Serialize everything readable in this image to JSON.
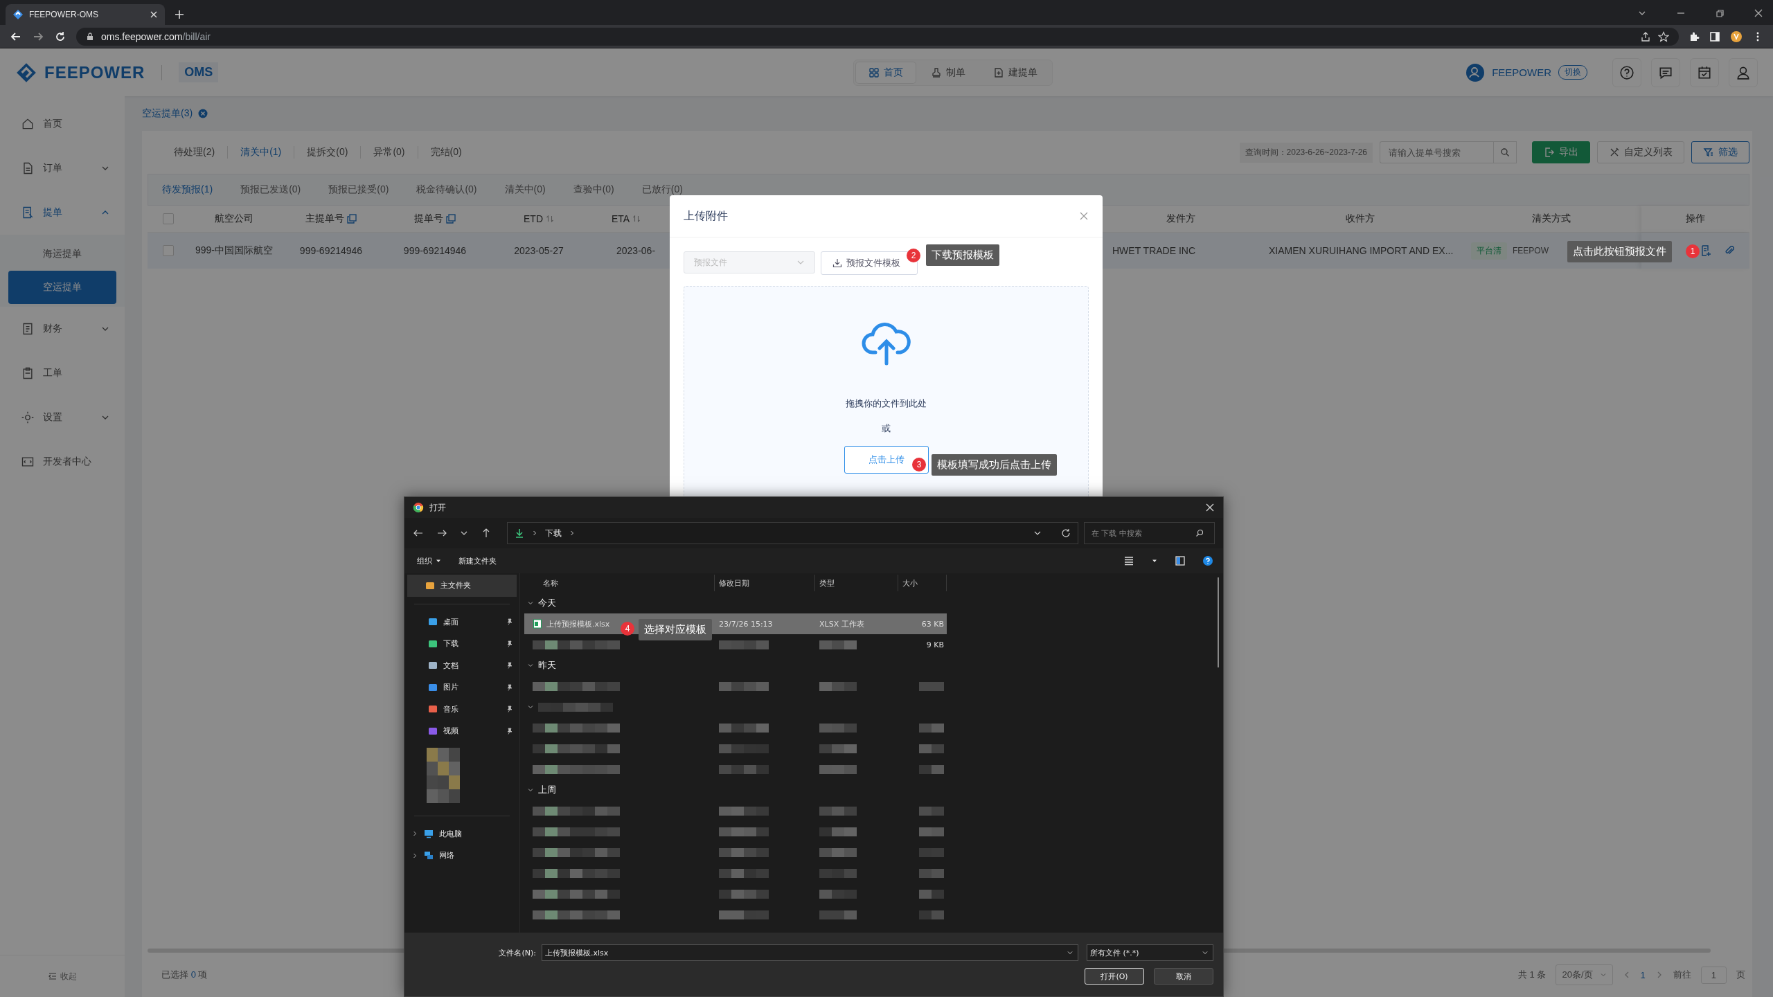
{
  "browser": {
    "tab_title": "FEEPOWER-OMS",
    "url_host": "oms.feepower.com",
    "url_path": "/bill/air"
  },
  "header": {
    "logo": "FEEPOWER",
    "product": "OMS",
    "nav": [
      {
        "label": "首页",
        "selected": true
      },
      {
        "label": "制单",
        "selected": false
      },
      {
        "label": "建提单",
        "selected": false
      }
    ],
    "company": "FEEPOWER",
    "switch_label": "切换"
  },
  "sidebar": {
    "items": [
      {
        "label": "首页",
        "selected": false
      },
      {
        "label": "订单",
        "selected": false,
        "expanded": false
      },
      {
        "label": "提单",
        "selected": true,
        "expanded": true,
        "children": [
          {
            "label": "海运提单",
            "selected": false
          },
          {
            "label": "空运提单",
            "selected": true
          }
        ]
      },
      {
        "label": "财务",
        "selected": false,
        "expanded": false
      },
      {
        "label": "工单",
        "selected": false
      },
      {
        "label": "设置",
        "selected": false,
        "expanded": false
      },
      {
        "label": "开发者中心",
        "selected": false
      }
    ],
    "collapse_label": "收起"
  },
  "page_tab": "空运提单(3)",
  "status_tabs": [
    {
      "label": "待处理(2)",
      "selected": false
    },
    {
      "label": "清关中(1)",
      "selected": true
    },
    {
      "label": "提拆交(0)",
      "selected": false
    },
    {
      "label": "异常(0)",
      "selected": false
    },
    {
      "label": "完结(0)",
      "selected": false
    }
  ],
  "query_time": "查询时间：2023-6-26~2023-7-26",
  "search": {
    "placeholder": "请输入提单号搜索"
  },
  "toolbar_buttons": [
    {
      "label": "导出",
      "kind": "primary"
    },
    {
      "label": "自定义列表",
      "kind": "default"
    },
    {
      "label": "筛选",
      "kind": "outline"
    }
  ],
  "sub_tabs": [
    {
      "label": "待发预报(1)",
      "selected": true
    },
    {
      "label": "预报已发送(0)",
      "selected": false
    },
    {
      "label": "预报已接受(0)",
      "selected": false
    },
    {
      "label": "税金待确认(0)",
      "selected": false
    },
    {
      "label": "清关中(0)",
      "selected": false
    },
    {
      "label": "查验中(0)",
      "selected": false
    },
    {
      "label": "已放行(0)",
      "selected": false
    }
  ],
  "table": {
    "header_checked": false,
    "columns": [
      {
        "label": "航空公司",
        "kind": "plain"
      },
      {
        "label": "主提单号",
        "kind": "copy"
      },
      {
        "label": "提单号",
        "kind": "copy"
      },
      {
        "label": "ETD",
        "kind": "sort"
      },
      {
        "label": "ETA",
        "kind": "sort"
      },
      {
        "label": "发件方",
        "kind": "plain"
      },
      {
        "label": "收件方",
        "kind": "plain"
      },
      {
        "label": "清关方式",
        "kind": "plain"
      },
      {
        "label": "操作",
        "kind": "plain"
      }
    ],
    "rows": [
      {
        "checked": false,
        "cells": [
          "999-中国国际航空",
          "999-69214946",
          "999-69214946",
          "2023-05-27",
          "2023-06-",
          "HWET TRADE INC",
          "XIAMEN XURUIHANG IMPORT AND EX..."
        ],
        "clearance_tag": "平台清",
        "clearance_text": "FEEPOW"
      }
    ]
  },
  "pagination": {
    "selected": "已选择 **0** 项",
    "total": "共 1 条",
    "page_size": "20条/页",
    "current_page": "1",
    "goto_label": "前往",
    "goto_value": "1",
    "goto_suffix": "页"
  },
  "upload_modal": {
    "title": "上传附件",
    "file_type": {
      "placeholder": "预报文件",
      "disabled": true
    },
    "template_button": "预报文件模板",
    "drop_text": "拖拽你的文件到此处",
    "or_text": "或",
    "upload_button": "点击上传"
  },
  "guide_tips": [
    {
      "badge": "2",
      "text": "下载预报模板"
    },
    {
      "badge": "1",
      "text": "点击此按钮预报文件"
    },
    {
      "badge": "3",
      "text": "模板填写成功后点击上传"
    },
    {
      "badge": "4",
      "text": "选择对应模板"
    }
  ],
  "file_dialog": {
    "title": "打开",
    "path": "下载",
    "search_placeholder": "在 下载 中搜索",
    "commands": [
      "组织",
      "新建文件夹"
    ],
    "nav_items": [
      {
        "label": "主文件夹",
        "selected": true,
        "pinned": false
      },
      {
        "label": "桌面",
        "selected": false,
        "pinned": true
      },
      {
        "label": "下载",
        "selected": false,
        "pinned": true
      },
      {
        "label": "文档",
        "selected": false,
        "pinned": true
      },
      {
        "label": "图片",
        "selected": false,
        "pinned": true
      },
      {
        "label": "音乐",
        "selected": false,
        "pinned": true
      },
      {
        "label": "视频",
        "selected": false,
        "pinned": true
      }
    ],
    "nav_devices": [
      {
        "label": "此电脑",
        "expanded": false
      },
      {
        "label": "网络",
        "expanded": false
      }
    ],
    "columns": [
      "名称",
      "修改日期",
      "类型",
      "大小"
    ],
    "groups": [
      {
        "kind": "labeled",
        "label": "今天",
        "rows": [
          {
            "kind": "file",
            "name": "上传预报模板.xlsx",
            "modified": "23/7/26 15:13",
            "type": "XLSX 工作表",
            "size": "63 KB",
            "selected": true
          },
          {
            "kind": "redacted",
            "size": "9 KB"
          }
        ]
      },
      {
        "kind": "labeled",
        "label": "昨天",
        "rows": [
          {
            "kind": "redacted"
          }
        ]
      },
      {
        "kind": "redacted",
        "rows": [
          {
            "kind": "redacted"
          },
          {
            "kind": "redacted"
          },
          {
            "kind": "redacted"
          }
        ]
      },
      {
        "kind": "labeled",
        "label": "上周",
        "rows": [
          {
            "kind": "redacted"
          },
          {
            "kind": "redacted"
          },
          {
            "kind": "redacted"
          },
          {
            "kind": "redacted"
          },
          {
            "kind": "redacted"
          },
          {
            "kind": "redacted"
          }
        ]
      }
    ],
    "file_name_label": "文件名(N):",
    "file_name": "上传预报模板.xlsx",
    "file_type": "所有文件 (*.*)",
    "buttons": [
      "打开(O)",
      "取消"
    ]
  }
}
